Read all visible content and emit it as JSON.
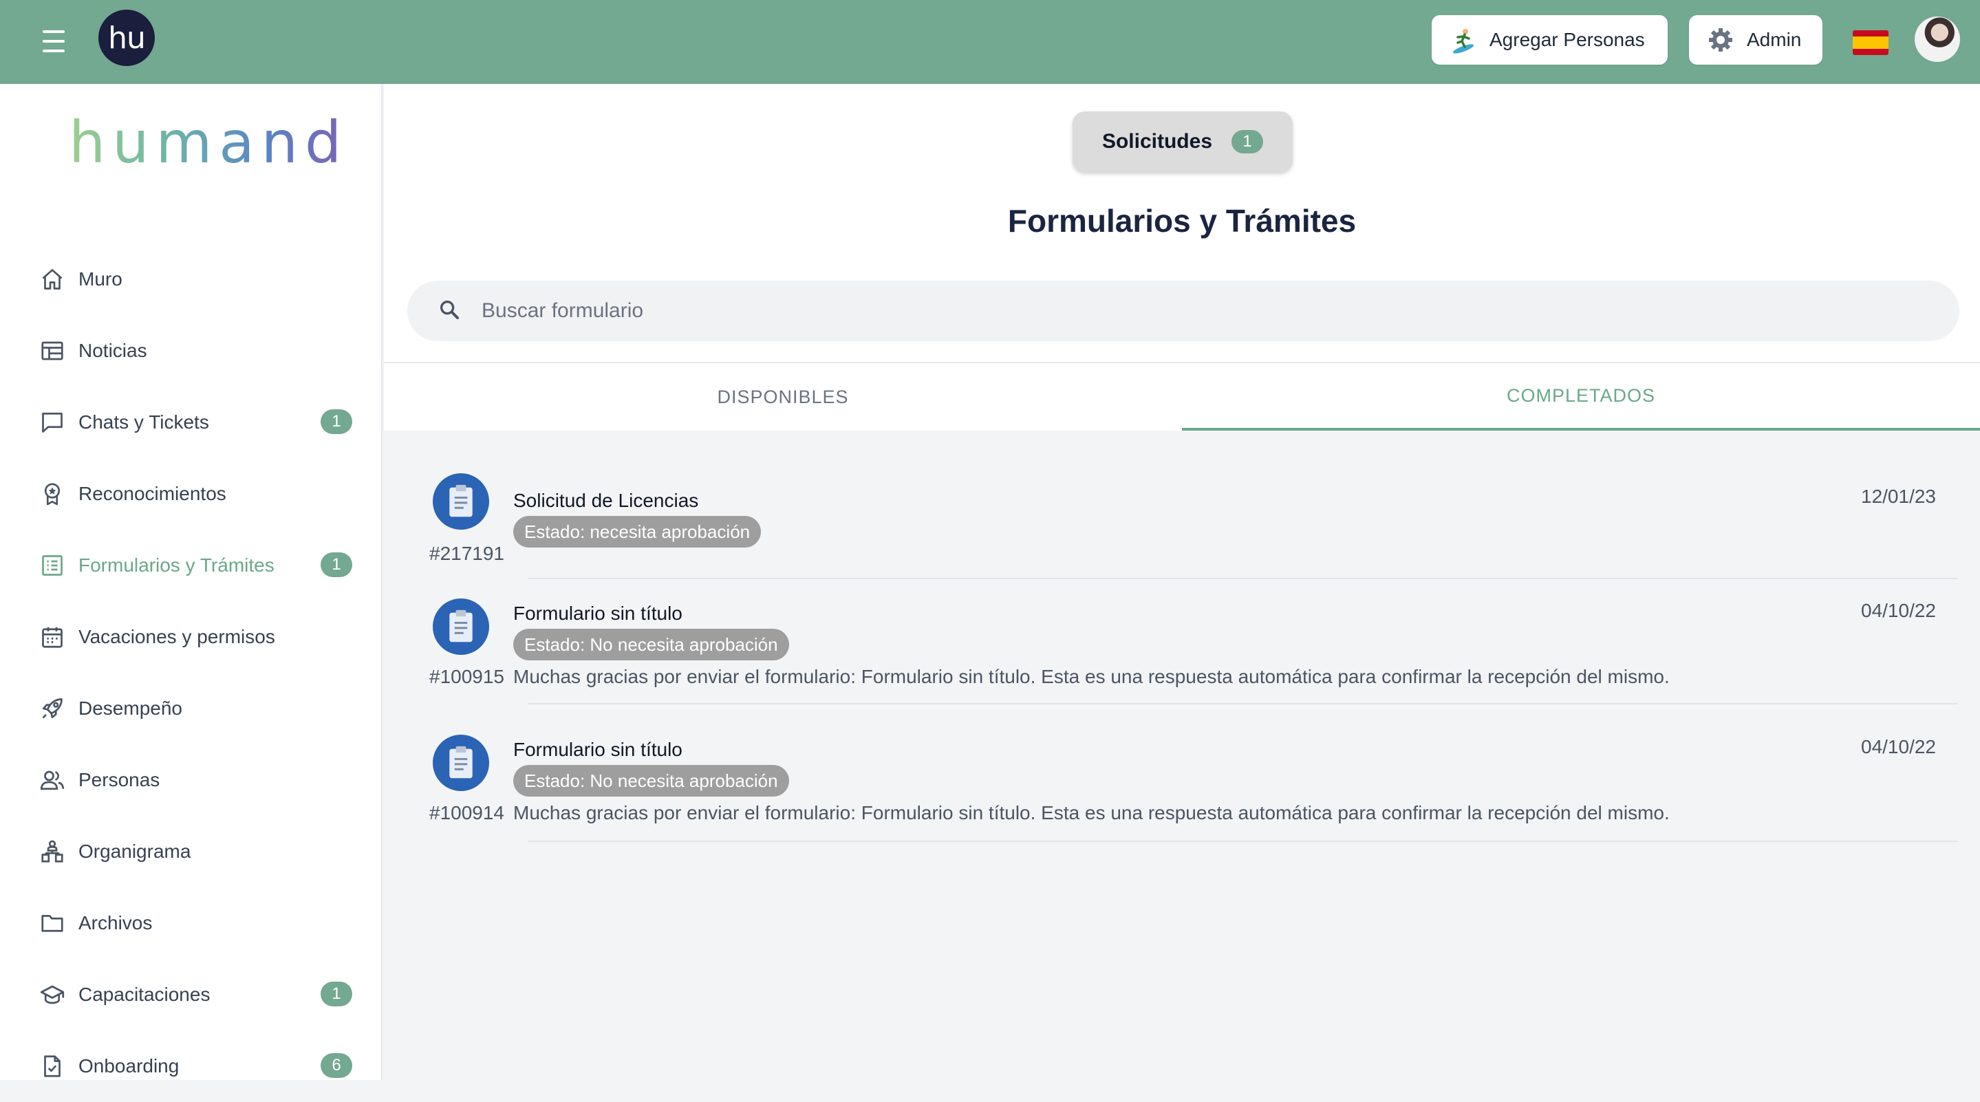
{
  "topbar": {
    "menu_icon": "hamburger-icon",
    "logo_text": "hu",
    "add_people_label": "Agregar Personas",
    "add_people_icon": "surfer-icon",
    "admin_label": "Admin",
    "admin_icon": "gear-icon",
    "language_icon": "spain-flag-icon",
    "avatar_icon": "user-avatar"
  },
  "sidebar": {
    "brand": "humand",
    "items": [
      {
        "label": "Muro",
        "icon": "home-icon",
        "badge": ""
      },
      {
        "label": "Noticias",
        "icon": "news-icon",
        "badge": ""
      },
      {
        "label": "Chats y Tickets",
        "icon": "chat-icon",
        "badge": "1"
      },
      {
        "label": "Reconocimientos",
        "icon": "award-icon",
        "badge": ""
      },
      {
        "label": "Formularios y Trámites",
        "icon": "form-list-icon",
        "badge": "1",
        "active": true
      },
      {
        "label": "Vacaciones y permisos",
        "icon": "calendar-icon",
        "badge": ""
      },
      {
        "label": "Desempeño",
        "icon": "rocket-icon",
        "badge": ""
      },
      {
        "label": "Personas",
        "icon": "people-icon",
        "badge": ""
      },
      {
        "label": "Organigrama",
        "icon": "org-chart-icon",
        "badge": ""
      },
      {
        "label": "Archivos",
        "icon": "folder-icon",
        "badge": ""
      },
      {
        "label": "Capacitaciones",
        "icon": "graduation-cap-icon",
        "badge": "1"
      },
      {
        "label": "Onboarding",
        "icon": "checklist-doc-icon",
        "badge": "6"
      }
    ]
  },
  "main": {
    "requests_label": "Solicitudes",
    "requests_count": "1",
    "title": "Formularios y Trámites",
    "search_placeholder": "Buscar formulario",
    "tabs": [
      {
        "label": "DISPONIBLES",
        "active": false
      },
      {
        "label": "COMPLETADOS",
        "active": true
      }
    ],
    "items": [
      {
        "title": "Solicitud de Licencias",
        "status": "Estado: necesita aprobación",
        "number": "#217191",
        "description": "",
        "date": "12/01/23"
      },
      {
        "title": "Formulario sin título",
        "status": "Estado: No necesita aprobación",
        "number": "#100915",
        "description": "Muchas gracias por enviar el formulario: Formulario sin título. Esta es una respuesta automática para confirmar la recepción del mismo.",
        "date": "04/10/22"
      },
      {
        "title": "Formulario sin título",
        "status": "Estado: No necesita aprobación",
        "number": "#100914",
        "description": "Muchas gracias por enviar el formulario: Formulario sin título. Esta es una respuesta automática para confirmar la recepción del mismo.",
        "date": "04/10/22"
      }
    ]
  },
  "colors": {
    "topbar": "#73a891",
    "accent": "#6aa88a",
    "form_icon_bg": "#2b63b5",
    "status_badge": "#9e9e9e",
    "title_text": "#1b2440"
  }
}
